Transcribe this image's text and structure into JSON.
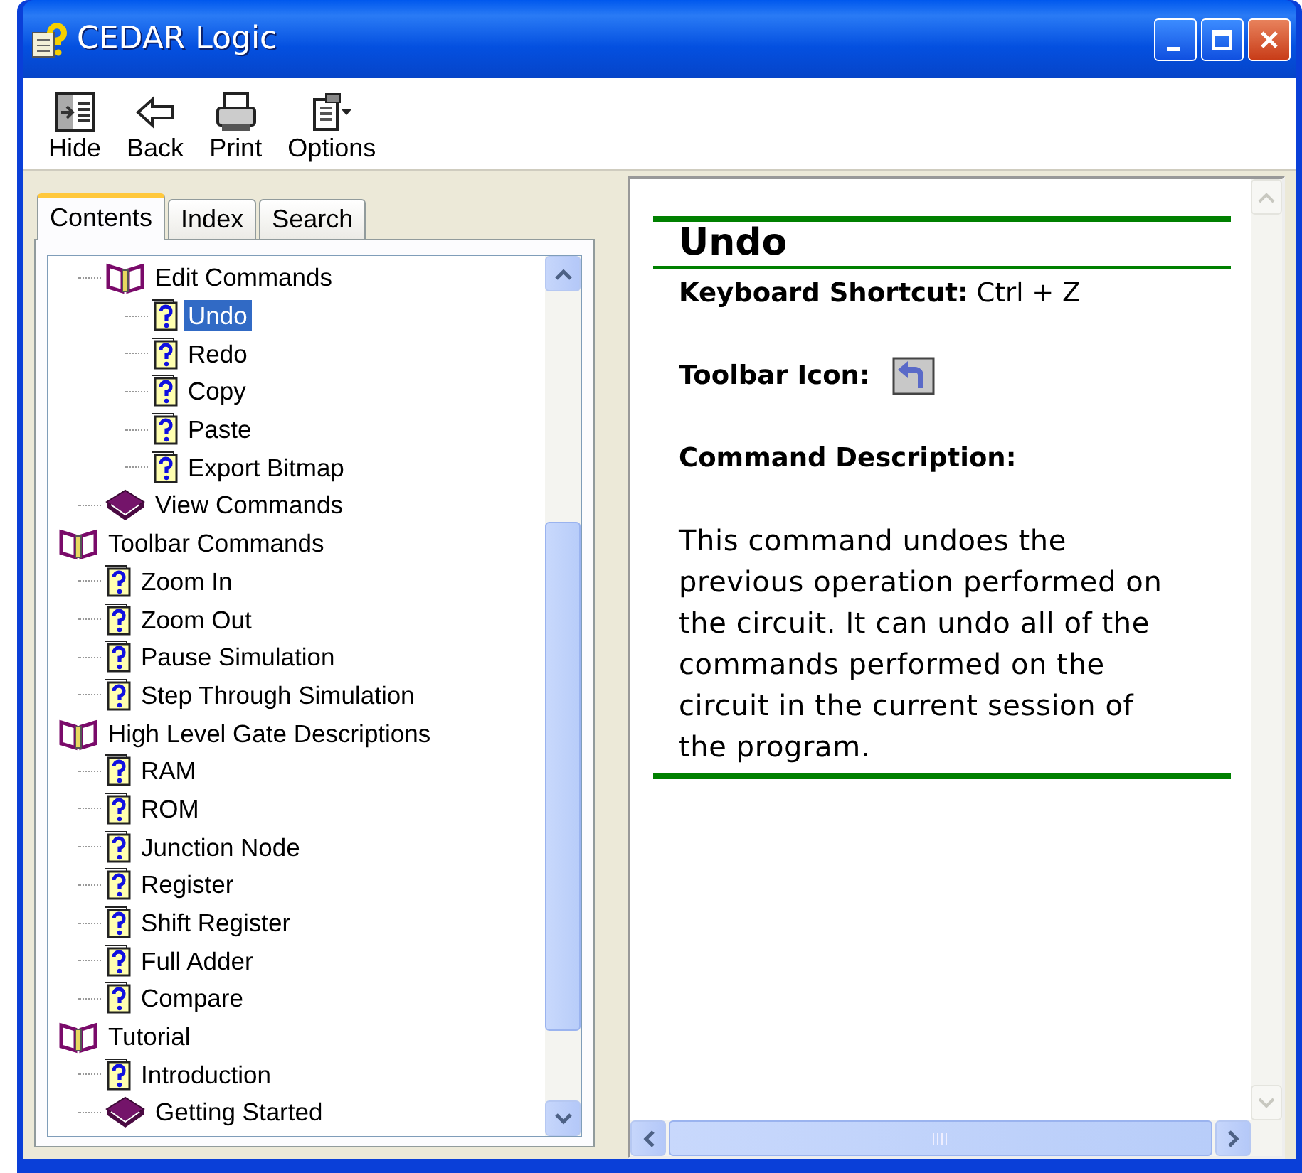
{
  "window": {
    "title": "CEDAR Logic"
  },
  "toolbar": [
    {
      "kind": "hide",
      "label": "Hide"
    },
    {
      "kind": "back",
      "label": "Back"
    },
    {
      "kind": "print",
      "label": "Print"
    },
    {
      "kind": "options",
      "label": "Options"
    }
  ],
  "tabs": [
    {
      "label": "Contents",
      "selected": true
    },
    {
      "label": "Index",
      "selected": false
    },
    {
      "label": "Search",
      "selected": false
    }
  ],
  "tree": [
    {
      "kind": "offscreen",
      "children": [
        {
          "kind": "book",
          "label": "Edit Commands",
          "expanded": true,
          "selected": false,
          "children": [
            {
              "kind": "topic",
              "label": "Undo",
              "selected": true
            },
            {
              "kind": "topic",
              "label": "Redo",
              "selected": false
            },
            {
              "kind": "topic",
              "label": "Copy",
              "selected": false
            },
            {
              "kind": "topic",
              "label": "Paste",
              "selected": false
            },
            {
              "kind": "topic",
              "label": "Export Bitmap",
              "selected": false
            }
          ]
        },
        {
          "kind": "book",
          "label": "View Commands",
          "expanded": false,
          "selected": false
        }
      ]
    },
    {
      "kind": "book",
      "label": "Toolbar Commands",
      "expanded": true,
      "selected": false,
      "children": [
        {
          "kind": "topic",
          "label": "Zoom In",
          "selected": false
        },
        {
          "kind": "topic",
          "label": "Zoom Out",
          "selected": false
        },
        {
          "kind": "topic",
          "label": "Pause Simulation",
          "selected": false
        },
        {
          "kind": "topic",
          "label": "Step Through Simulation",
          "selected": false
        }
      ]
    },
    {
      "kind": "book",
      "label": "High Level Gate Descriptions",
      "expanded": true,
      "selected": false,
      "children": [
        {
          "kind": "topic",
          "label": "RAM",
          "selected": false
        },
        {
          "kind": "topic",
          "label": "ROM",
          "selected": false
        },
        {
          "kind": "topic",
          "label": "Junction Node",
          "selected": false
        },
        {
          "kind": "topic",
          "label": "Register",
          "selected": false
        },
        {
          "kind": "topic",
          "label": "Shift Register",
          "selected": false
        },
        {
          "kind": "topic",
          "label": "Full Adder",
          "selected": false
        },
        {
          "kind": "topic",
          "label": "Compare",
          "selected": false
        }
      ]
    },
    {
      "kind": "book",
      "label": "Tutorial",
      "expanded": true,
      "selected": false,
      "children": [
        {
          "kind": "topic",
          "label": "Introduction",
          "selected": false
        },
        {
          "kind": "book",
          "label": "Getting Started",
          "expanded": false,
          "selected": false
        }
      ]
    }
  ],
  "topic": {
    "title": "Undo",
    "shortcut": "**Keyboard Shortcut:** Ctrl + Z",
    "icon_label": "Toolbar Icon:",
    "description_heading": "Command Description:",
    "description": "This command undoes the previous operation performed on the circuit. It can undo all of the commands performed on the circuit in the current session of the program."
  }
}
